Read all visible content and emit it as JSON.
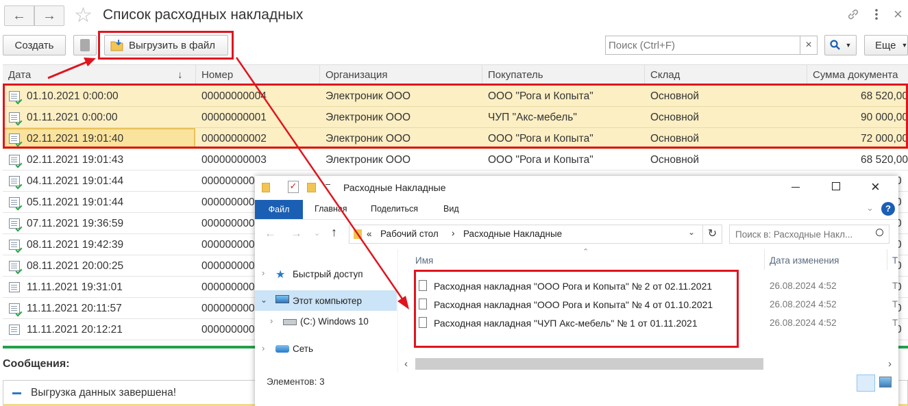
{
  "window": {
    "title": "Список расходных накладных"
  },
  "toolbar": {
    "create_label": "Создать",
    "export_label": "Выгрузить в файл",
    "search_placeholder": "Поиск (Ctrl+F)",
    "clear_glyph": "×",
    "more_label": "Еще"
  },
  "grid": {
    "columns": [
      "Дата",
      "Номер",
      "Организация",
      "Покупатель",
      "Склад",
      "Сумма документа"
    ],
    "rows": [
      {
        "date": "01.10.2021 0:00:00",
        "number": "00000000004",
        "org": "Электроник ООО",
        "buyer": "ООО \"Рога и Копыта\"",
        "warehouse": "Основной",
        "sum": "68 520,00"
      },
      {
        "date": "01.11.2021 0:00:00",
        "number": "00000000001",
        "org": "Электроник ООО",
        "buyer": "ЧУП \"Акс-мебель\"",
        "warehouse": "Основной",
        "sum": "90 000,00"
      },
      {
        "date": "02.11.2021 19:01:40",
        "number": "00000000002",
        "org": "Электроник ООО",
        "buyer": "ООО \"Рога и Копыта\"",
        "warehouse": "Основной",
        "sum": "72 000,00"
      },
      {
        "date": "02.11.2021 19:01:43",
        "number": "00000000003",
        "org": "Электроник ООО",
        "buyer": "ООО \"Рога и Копыта\"",
        "warehouse": "Основной",
        "sum": "68 520,00"
      },
      {
        "date": "04.11.2021 19:01:44",
        "number": "000000000"
      },
      {
        "date": "05.11.2021 19:01:44",
        "number": "000000000"
      },
      {
        "date": "07.11.2021 19:36:59",
        "number": "000000000"
      },
      {
        "date": "08.11.2021 19:42:39",
        "number": "000000000"
      },
      {
        "date": "08.11.2021 20:00:25",
        "number": "000000000"
      },
      {
        "date": "11.11.2021 19:31:01",
        "number": "000000000"
      },
      {
        "date": "11.11.2021 20:11:57",
        "number": "000000000"
      },
      {
        "date": "11.11.2021 20:12:21",
        "number": "000000000"
      }
    ],
    "right_edge_glyphs": [
      "0",
      "0",
      "0",
      "0",
      "0",
      "0",
      "0",
      "0"
    ]
  },
  "messages": {
    "title": "Сообщения:",
    "text": "Выгрузка данных завершена!"
  },
  "explorer": {
    "title": "Расходные Накладные",
    "tabs": [
      "Файл",
      "Главная",
      "Поделиться",
      "Вид"
    ],
    "help": "?",
    "breadcrumb": [
      "Рабочий стол",
      "Расходные Накладные"
    ],
    "breadcrumb_prefix": "«",
    "search_placeholder": "Поиск в: Расходные Накл...",
    "nav": [
      "Быстрый доступ",
      "Этот компьютер",
      "(C:) Windows 10",
      "Сеть"
    ],
    "columns": [
      "Имя",
      "Дата изменения",
      "Т"
    ],
    "files": [
      {
        "name": "Расходная накладная \"ООО Рога и Копыта\" № 2 от 02.11.2021",
        "date": "26.08.2024 4:52",
        "type": "Т"
      },
      {
        "name": "Расходная накладная \"ООО Рога и Копыта\" № 4 от 01.10.2021",
        "date": "26.08.2024 4:52",
        "type": "Т"
      },
      {
        "name": "Расходная накладная \"ЧУП Акс-мебель\" № 1 от 01.11.2021",
        "date": "26.08.2024 4:52",
        "type": "Т"
      }
    ],
    "status": "Элементов: 3"
  },
  "colors": {
    "annotation_red": "#e0141e",
    "selected_row": "#fcefc4",
    "explorer_file_tab": "#1a5fb4"
  }
}
